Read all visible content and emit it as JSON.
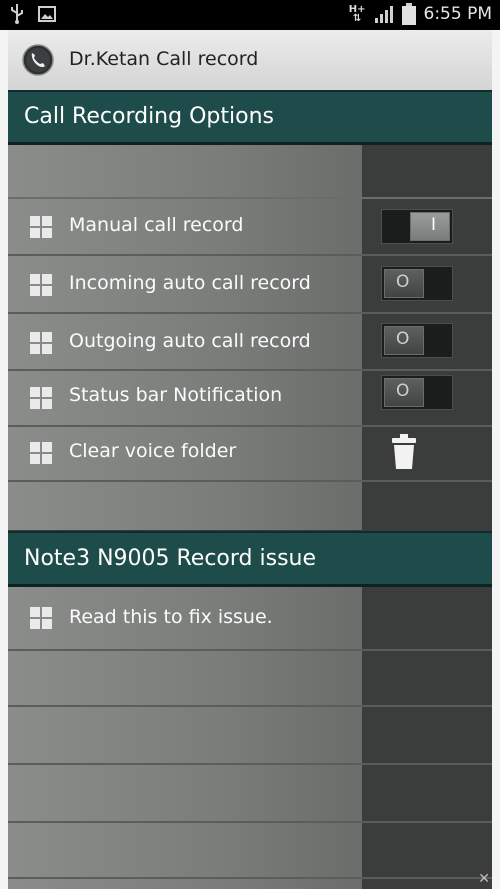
{
  "status_bar": {
    "time": "6:55 PM",
    "network": "H+",
    "icons": [
      "usb-icon",
      "image-icon",
      "signal-icon",
      "battery-icon"
    ]
  },
  "app": {
    "title": "Dr.Ketan Call record",
    "icon": "phone-icon"
  },
  "sections": [
    {
      "title": "Call Recording Options",
      "items": [
        {
          "label": "Manual call record",
          "control": "toggle",
          "state": "on",
          "mark": "I"
        },
        {
          "label": "Incoming auto call record",
          "control": "toggle",
          "state": "off",
          "mark": "O"
        },
        {
          "label": "Outgoing auto call record",
          "control": "toggle",
          "state": "off",
          "mark": "O"
        },
        {
          "label": "Status bar Notification",
          "control": "toggle",
          "state": "off",
          "mark": "O"
        },
        {
          "label": "Clear voice folder",
          "control": "trash-icon"
        }
      ]
    },
    {
      "title": "Note3 N9005 Record issue",
      "items": [
        {
          "label": "Read this to fix issue."
        }
      ]
    }
  ],
  "colors": {
    "header_bg": "#1d4c4a",
    "panel_left": "#7f827f",
    "panel_right": "#3b3d3c"
  }
}
